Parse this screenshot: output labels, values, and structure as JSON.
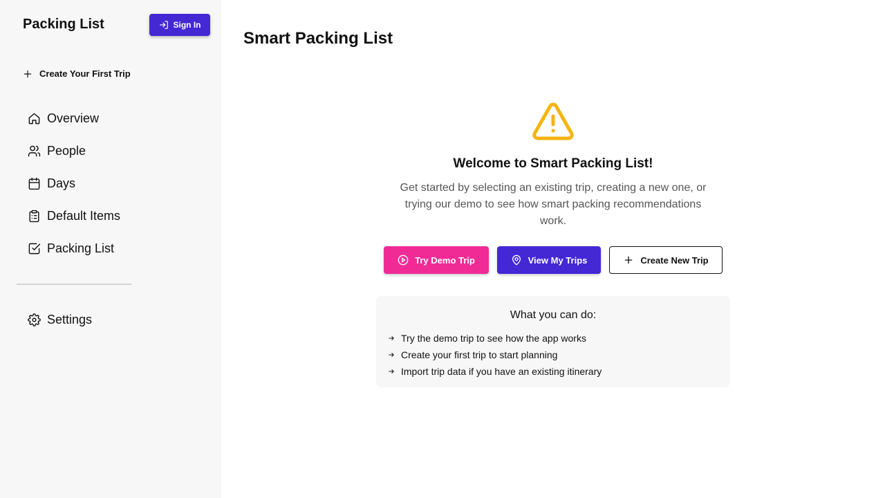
{
  "sidebar": {
    "app_title": "Packing List",
    "signin_label": "Sign In",
    "create_first_trip_label": "Create Your First Trip",
    "nav": [
      {
        "label": "Overview",
        "icon": "home-icon"
      },
      {
        "label": "People",
        "icon": "users-icon"
      },
      {
        "label": "Days",
        "icon": "calendar-icon"
      },
      {
        "label": "Default Items",
        "icon": "clipboard-list-icon"
      },
      {
        "label": "Packing List",
        "icon": "check-square-icon"
      }
    ],
    "settings_label": "Settings"
  },
  "main": {
    "page_title": "Smart Packing List",
    "welcome": {
      "icon": "warning-triangle-icon",
      "icon_color": "#f6b40e",
      "title": "Welcome to Smart Packing List!",
      "description": "Get started by selecting an existing trip, creating a new one, or trying our demo to see how smart packing recommendations work."
    },
    "actions": {
      "demo_label": "Try Demo Trip",
      "trips_label": "View My Trips",
      "create_label": "Create New Trip"
    },
    "info": {
      "title": "What you can do:",
      "items": [
        "Try the demo trip to see how the app works",
        "Create your first trip to start planning",
        "Import trip data if you have an existing itinerary"
      ]
    }
  },
  "colors": {
    "primary": "#4328d4",
    "accent": "#f02b96",
    "warning": "#f6b40e",
    "sidebar_bg": "#f7f7f7"
  }
}
